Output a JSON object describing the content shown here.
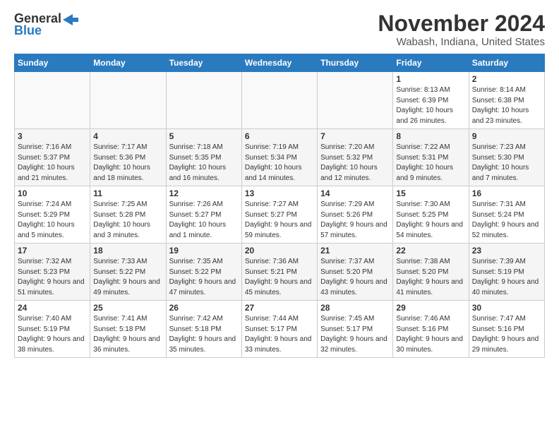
{
  "header": {
    "logo_general": "General",
    "logo_blue": "Blue",
    "month_title": "November 2024",
    "location": "Wabash, Indiana, United States"
  },
  "days_of_week": [
    "Sunday",
    "Monday",
    "Tuesday",
    "Wednesday",
    "Thursday",
    "Friday",
    "Saturday"
  ],
  "weeks": [
    [
      {
        "day": "",
        "info": ""
      },
      {
        "day": "",
        "info": ""
      },
      {
        "day": "",
        "info": ""
      },
      {
        "day": "",
        "info": ""
      },
      {
        "day": "",
        "info": ""
      },
      {
        "day": "1",
        "info": "Sunrise: 8:13 AM\nSunset: 6:39 PM\nDaylight: 10 hours and 26 minutes."
      },
      {
        "day": "2",
        "info": "Sunrise: 8:14 AM\nSunset: 6:38 PM\nDaylight: 10 hours and 23 minutes."
      }
    ],
    [
      {
        "day": "3",
        "info": "Sunrise: 7:16 AM\nSunset: 5:37 PM\nDaylight: 10 hours and 21 minutes."
      },
      {
        "day": "4",
        "info": "Sunrise: 7:17 AM\nSunset: 5:36 PM\nDaylight: 10 hours and 18 minutes."
      },
      {
        "day": "5",
        "info": "Sunrise: 7:18 AM\nSunset: 5:35 PM\nDaylight: 10 hours and 16 minutes."
      },
      {
        "day": "6",
        "info": "Sunrise: 7:19 AM\nSunset: 5:34 PM\nDaylight: 10 hours and 14 minutes."
      },
      {
        "day": "7",
        "info": "Sunrise: 7:20 AM\nSunset: 5:32 PM\nDaylight: 10 hours and 12 minutes."
      },
      {
        "day": "8",
        "info": "Sunrise: 7:22 AM\nSunset: 5:31 PM\nDaylight: 10 hours and 9 minutes."
      },
      {
        "day": "9",
        "info": "Sunrise: 7:23 AM\nSunset: 5:30 PM\nDaylight: 10 hours and 7 minutes."
      }
    ],
    [
      {
        "day": "10",
        "info": "Sunrise: 7:24 AM\nSunset: 5:29 PM\nDaylight: 10 hours and 5 minutes."
      },
      {
        "day": "11",
        "info": "Sunrise: 7:25 AM\nSunset: 5:28 PM\nDaylight: 10 hours and 3 minutes."
      },
      {
        "day": "12",
        "info": "Sunrise: 7:26 AM\nSunset: 5:27 PM\nDaylight: 10 hours and 1 minute."
      },
      {
        "day": "13",
        "info": "Sunrise: 7:27 AM\nSunset: 5:27 PM\nDaylight: 9 hours and 59 minutes."
      },
      {
        "day": "14",
        "info": "Sunrise: 7:29 AM\nSunset: 5:26 PM\nDaylight: 9 hours and 57 minutes."
      },
      {
        "day": "15",
        "info": "Sunrise: 7:30 AM\nSunset: 5:25 PM\nDaylight: 9 hours and 54 minutes."
      },
      {
        "day": "16",
        "info": "Sunrise: 7:31 AM\nSunset: 5:24 PM\nDaylight: 9 hours and 52 minutes."
      }
    ],
    [
      {
        "day": "17",
        "info": "Sunrise: 7:32 AM\nSunset: 5:23 PM\nDaylight: 9 hours and 51 minutes."
      },
      {
        "day": "18",
        "info": "Sunrise: 7:33 AM\nSunset: 5:22 PM\nDaylight: 9 hours and 49 minutes."
      },
      {
        "day": "19",
        "info": "Sunrise: 7:35 AM\nSunset: 5:22 PM\nDaylight: 9 hours and 47 minutes."
      },
      {
        "day": "20",
        "info": "Sunrise: 7:36 AM\nSunset: 5:21 PM\nDaylight: 9 hours and 45 minutes."
      },
      {
        "day": "21",
        "info": "Sunrise: 7:37 AM\nSunset: 5:20 PM\nDaylight: 9 hours and 43 minutes."
      },
      {
        "day": "22",
        "info": "Sunrise: 7:38 AM\nSunset: 5:20 PM\nDaylight: 9 hours and 41 minutes."
      },
      {
        "day": "23",
        "info": "Sunrise: 7:39 AM\nSunset: 5:19 PM\nDaylight: 9 hours and 40 minutes."
      }
    ],
    [
      {
        "day": "24",
        "info": "Sunrise: 7:40 AM\nSunset: 5:19 PM\nDaylight: 9 hours and 38 minutes."
      },
      {
        "day": "25",
        "info": "Sunrise: 7:41 AM\nSunset: 5:18 PM\nDaylight: 9 hours and 36 minutes."
      },
      {
        "day": "26",
        "info": "Sunrise: 7:42 AM\nSunset: 5:18 PM\nDaylight: 9 hours and 35 minutes."
      },
      {
        "day": "27",
        "info": "Sunrise: 7:44 AM\nSunset: 5:17 PM\nDaylight: 9 hours and 33 minutes."
      },
      {
        "day": "28",
        "info": "Sunrise: 7:45 AM\nSunset: 5:17 PM\nDaylight: 9 hours and 32 minutes."
      },
      {
        "day": "29",
        "info": "Sunrise: 7:46 AM\nSunset: 5:16 PM\nDaylight: 9 hours and 30 minutes."
      },
      {
        "day": "30",
        "info": "Sunrise: 7:47 AM\nSunset: 5:16 PM\nDaylight: 9 hours and 29 minutes."
      }
    ]
  ]
}
